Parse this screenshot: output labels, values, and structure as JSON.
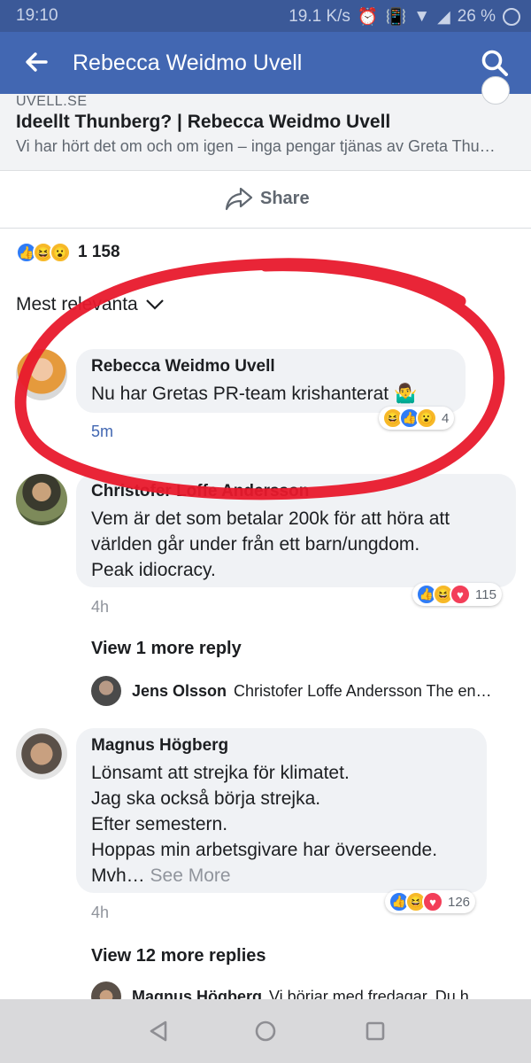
{
  "status_bar": {
    "time": "19:10",
    "speed": "19.1 K/s",
    "battery": "26 %"
  },
  "app_bar": {
    "title": "Rebecca Weidmo Uvell"
  },
  "link_card": {
    "domain": "UVELL.SE",
    "headline": "Ideellt Thunberg? | Rebecca Weidmo Uvell",
    "description": "Vi har hört det om och om igen – inga pengar tjänas av Greta Thu…"
  },
  "share": {
    "label": "Share"
  },
  "reactions_summary": {
    "count": "1 158"
  },
  "sort": {
    "label": "Mest relevanta"
  },
  "comments": [
    {
      "author": "Rebecca Weidmo Uvell",
      "text": "Nu har Gretas PR-team krishanterat 🤷‍♂️",
      "time": "5m",
      "reaction_count": "4"
    },
    {
      "author": "Christofer Loffe Andersson",
      "text_lines": [
        "Vem är det som betalar 200k för att höra att",
        "världen går under från ett barn/ungdom.",
        "Peak idiocracy."
      ],
      "time": "4h",
      "reaction_count": "115",
      "view_more": "View 1 more reply",
      "reply_preview": {
        "name": "Jens Olsson",
        "text": "Christofer Loffe Andersson The en…"
      }
    },
    {
      "author": "Magnus Högberg",
      "text_lines": [
        "Lönsamt att strejka för klimatet.",
        "Jag ska också börja strejka.",
        "Efter semestern.",
        "Hoppas min arbetsgivare har överseende.",
        "Mvh…"
      ],
      "see_more": "See More",
      "time": "4h",
      "reaction_count": "126",
      "view_more": "View 12 more replies",
      "reply_preview": {
        "name": "Magnus Högberg",
        "text": "Vi börjar med fredagar. Du h…"
      }
    }
  ],
  "colors": {
    "brand": "#4267b2",
    "status_bar": "#3b5998",
    "annotation_red": "#e8192c",
    "like": "#2f7cf6",
    "love": "#f33e58",
    "haha": "#f7b928"
  }
}
